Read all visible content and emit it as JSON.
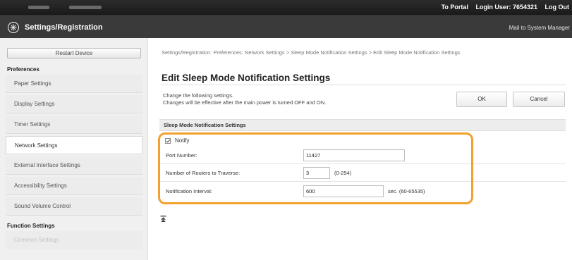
{
  "topbar": {
    "to_portal": "To Portal",
    "login_user": "Login User:  7654321",
    "logout": "Log Out"
  },
  "header": {
    "title": "Settings/Registration",
    "mail_link": "Mail to System Manager"
  },
  "sidebar": {
    "restart_label": "Restart Device",
    "preferences_heading": "Preferences",
    "items": [
      {
        "label": "Paper Settings"
      },
      {
        "label": "Display Settings"
      },
      {
        "label": "Timer Settings"
      },
      {
        "label": "Network Settings"
      },
      {
        "label": "External Interface Settings"
      },
      {
        "label": "Accessibility Settings"
      },
      {
        "label": "Sound Volume Control"
      }
    ],
    "function_heading": "Function Settings",
    "common_label": "Common Settings"
  },
  "main": {
    "breadcrumb": "Settings/Registration: Preferences: Network Settings > Sleep Mode Notification Settings > Edit Sleep Mode Notification Settings",
    "page_title": "Edit Sleep Mode Notification Settings",
    "desc_line1": "Change the following settings.",
    "desc_line2": "Changes will be effective after the main power is turned OFF and ON.",
    "ok_label": "OK",
    "cancel_label": "Cancel",
    "section_title": "Sleep Mode Notification Settings",
    "notify_label": "Notify",
    "notify_checked": true,
    "fields": {
      "port_label": "Port Number:",
      "port_value": "11427",
      "routers_label": "Number of Routers to Traverse:",
      "routers_value": "3",
      "routers_hint": "(0-254)",
      "interval_label": "Notification Interval:",
      "interval_value": "600",
      "interval_hint": "sec. (60-65535)"
    }
  },
  "colors": {
    "highlight": "#f2a12e",
    "header_bg": "#3a3a3a",
    "topbar_bg": "#222222"
  }
}
